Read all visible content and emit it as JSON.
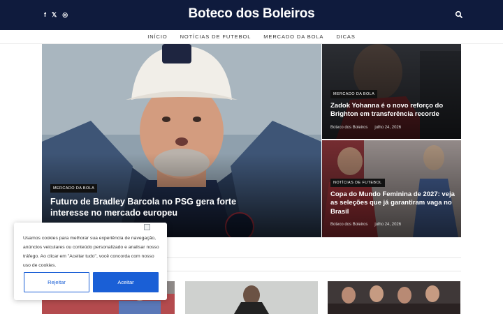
{
  "header": {
    "brand": "Boteco dos Boleiros",
    "social": [
      {
        "icon": "facebook-icon",
        "glyph": "f"
      },
      {
        "icon": "x-icon",
        "glyph": "𝕏"
      },
      {
        "icon": "instagram-icon",
        "glyph": "◎"
      }
    ],
    "search_icon": "search-icon"
  },
  "nav": {
    "items": [
      "Início",
      "Notícias de Futebol",
      "Mercado da Bola",
      "Dicas"
    ]
  },
  "featured": {
    "main": {
      "category": "Mercado da Bola",
      "title": "Futuro de Bradley Barcola no PSG gera forte interesse no mercado europeu"
    },
    "side": [
      {
        "category": "Mercado da Bola",
        "title": "Zadok Yohanna é o novo reforço do Brighton em transferência recorde",
        "author": "Boteco dos Boleiros",
        "date": "julho 24, 2026"
      },
      {
        "category": "Notícias de Futebol",
        "title": "Copa do Mundo Feminina de 2027: veja as seleções que já garantiram vaga no Brasil",
        "author": "Boteco dos Boleiros",
        "date": "julho 24, 2026"
      }
    ]
  },
  "cookie_banner": {
    "message": "Usamos cookies para melhorar sua experiência de navegação, anúncios veiculares ou conteúdo personalizado e analisar nosso tráfego. Ao clicar em \"Aceitar tudo\", você concorda com nosso uso de cookies.",
    "reject_label": "Rejeitar",
    "accept_label": "Aceitar"
  },
  "colors": {
    "header_bg": "#0f1b3d",
    "accent": "#1a5fd6"
  }
}
